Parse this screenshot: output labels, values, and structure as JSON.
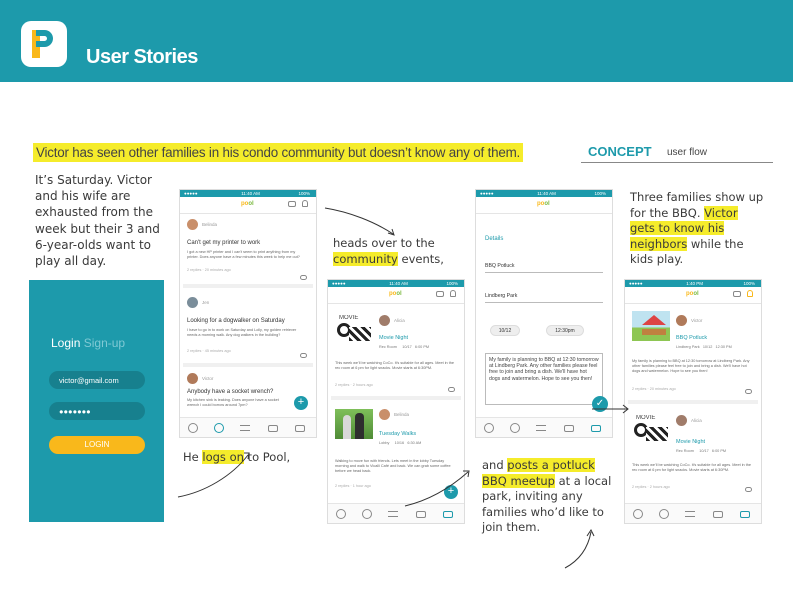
{
  "header": {
    "title": "User Stories"
  },
  "headline": "Victor has seen other families in his condo community but doesn’t know any of them.",
  "concept": {
    "label": "CONCEPT",
    "sub": "user flow"
  },
  "story": {
    "l1": "It’s Saturday. Victor",
    "l2": "and his wife are",
    "l3": "exhausted from the",
    "l4": "week but their 3 and",
    "l5": "6-year-olds want to",
    "l6": "play all day."
  },
  "login": {
    "tab_login": "Login",
    "tab_signup": "Sign-up",
    "email": "victor@gmail.com",
    "password": "●●●●●●●",
    "button": "LOGIN"
  },
  "captions": {
    "logs_pre": "He ",
    "logs_hl": "logs on",
    "logs_post": " to Pool,",
    "heads_l1": "heads over to the",
    "heads_hl": "community",
    "heads_post": " events,",
    "posts_pre": "and ",
    "posts_hl1": "posts a potluck",
    "posts_hl2": "BBQ meetup",
    "posts_l2_post": " at a local",
    "posts_l3": "park, inviting any",
    "posts_l4": "families who’d like to",
    "posts_l5": "join them.",
    "three_l1": "Three families show up",
    "three_l2_pre": "for the BBQ. ",
    "three_l2_hl": "Victor",
    "three_l3_hl": "gets to know his",
    "three_l4_hl": "neighbors",
    "three_l4_post": " while the",
    "three_l5": "kids play."
  },
  "phone": {
    "time": "11:40 AM",
    "time_2": "1:40 PM",
    "battery": "100%",
    "carrier": "●●●●●",
    "brand_a": "po",
    "brand_b": "ol"
  },
  "phone1": {
    "posts": [
      {
        "name": "Belinda",
        "title": "Can't get my printer to work",
        "body": "I got a new HP printer and I can't seem to print anything from my printer. Does anyone have a few minutes this week to help me out?",
        "meta": "2 replies · 20 minutes ago",
        "count": "2"
      },
      {
        "name": "Jen",
        "title": "Looking for a dogwalker on Saturday",
        "body": "I have to go in to work on Saturday and Lolly, my golden retriever needs a morning walk. Any dog walkers in the building?",
        "meta": "2 replies · 45 minutes ago",
        "count": "2"
      },
      {
        "name": "Victor",
        "title": "Anybody have a socket wrench?",
        "body": "My kitchen sink is leaking. Does anyone have a socket wrench I could borrow around 7pm?",
        "meta": "",
        "count": ""
      }
    ],
    "fab": "+"
  },
  "phone2": {
    "events": [
      {
        "img_text": "MOVIE",
        "name": "Alicia",
        "title": "Movie Night",
        "room": "Rec Room",
        "date": "10/17",
        "time": "6:00 PM",
        "body": "This week we'll be watching CoCo. It's suitable for all ages. Meet in the rec room at 6 pm for light snacks. Movie starts at 6:30PM.",
        "meta": "2 replies · 2 hours ago",
        "count": "2"
      },
      {
        "name": "Belinda",
        "title": "Tuesday Walks",
        "room": "Lobby",
        "date": "10/16",
        "time": "6:30 AM",
        "body": "Walking to move fun with friends. Lets meet in the lobby Tuesday morning and walk to Vicalli Café and back. We can grab some coffee before we head back.",
        "meta": "2 replies · 1 hour ago",
        "count": ""
      }
    ],
    "fab": "+"
  },
  "phone3": {
    "details": "Details",
    "event_name": "BBQ Potluck",
    "location": "Lindberg Park",
    "date": "10/12",
    "time": "12:30pm",
    "message": "My family is planning to BBQ at 12:30 tomorrow at Lindberg Park. Any other families please feel free to join and bring a dish. We'll have hot dogs and watermelon. Hope to see you then!",
    "check": "✓"
  },
  "phone4": {
    "events": [
      {
        "name": "Victor",
        "title": "BBQ Potluck",
        "room": "Lindberg Park",
        "date": "10/12",
        "time": "12:30 PM",
        "body": "My family is planning to BBQ at 12:30 tomorrow at Lindberg Park. Any other families please feel free to join and bring a dish. We'll have hot dogs and watermelon. Hope to see you then!",
        "meta": "2 replies · 20 minutes ago",
        "count": "3"
      },
      {
        "img_text": "MOVIE",
        "name": "Alicia",
        "title": "Movie Night",
        "room": "Rec Room",
        "date": "10/17",
        "time": "6:00 PM",
        "body": "This week we'll be watching CoCo. It's suitable for all ages. Meet in the rec room at 6 pm for light snacks. Movie starts at 6:30PM.",
        "meta": "2 replies · 2 hours ago",
        "count": "2"
      }
    ]
  },
  "icons": {
    "logo": "pool-logo-icon",
    "chat": "chat-icon",
    "bell": "bell-icon",
    "profile": "profile-icon",
    "help": "help-icon",
    "swap": "swap-icon",
    "car": "car-icon",
    "community": "community-icon",
    "plus": "plus-icon",
    "check": "check-icon",
    "comment": "comment-icon"
  },
  "colors": {
    "brand_teal": "#1d9aab",
    "highlight": "#f5ec2b",
    "accent_yellow": "#f9b81b",
    "brand_green": "#7ab93f"
  }
}
